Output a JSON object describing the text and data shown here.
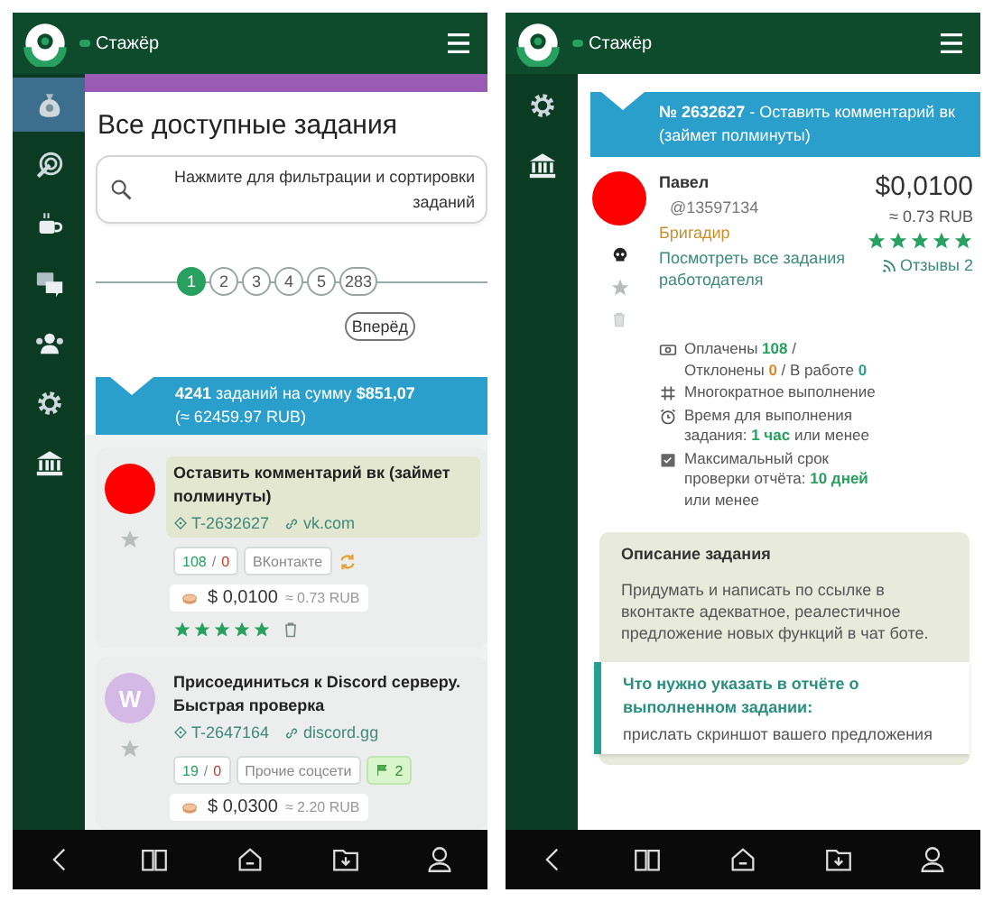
{
  "list_screen": {
    "header": {
      "role": "Стажёр"
    },
    "sidebar": [
      {
        "kind": "money",
        "selected": true
      },
      {
        "kind": "target",
        "selected": false
      },
      {
        "kind": "coffee",
        "selected": false
      },
      {
        "kind": "chat",
        "selected": false
      },
      {
        "kind": "people",
        "selected": false
      },
      {
        "kind": "gear",
        "selected": false
      },
      {
        "kind": "bank",
        "selected": false
      }
    ],
    "title": "Все доступные задания",
    "filter": {
      "label": "Нажмите для фильтрации и сортировки заданий"
    },
    "pagination": {
      "pages": [
        {
          "label": "1",
          "selected": true
        },
        {
          "label": "2",
          "selected": false
        },
        {
          "label": "3",
          "selected": false
        },
        {
          "label": "4",
          "selected": false
        },
        {
          "label": "5",
          "selected": false
        },
        {
          "label": "283",
          "selected": false
        }
      ],
      "next": "Вперёд"
    },
    "summary": {
      "text": "**4241** заданий на сумму **$851,07**",
      "rub": "(≈ 62459.97 RUB)"
    },
    "tasks": [
      {
        "title": "Оставить комментарий вк (займет полминуты)",
        "highlighted": true,
        "avatar": {
          "color": "#ff0000"
        },
        "id": "T-2632627",
        "site": "vk.com",
        "counts": "**108** / **0**",
        "category": "ВКонтакте",
        "repeat": true,
        "price": "$ 0,0100",
        "rub": "≈ 0.73 RUB",
        "stars": 5
      },
      {
        "title": "Присоединиться к Discord серверу. Быстрая проверка",
        "highlighted": false,
        "avatar": {
          "color": "#d4b8e6",
          "letter": "W"
        },
        "id": "T-2647164",
        "site": "discord.gg",
        "counts": "**19** / **0**",
        "category": "Прочие соцсети",
        "repeat": false,
        "bonus": "2",
        "price": "$ 0,0300",
        "rub": "≈ 2.20 RUB"
      }
    ]
  },
  "detail_screen": {
    "header": {
      "role": "Стажёр"
    },
    "sidebar": [
      {
        "kind": "gear",
        "selected": false
      },
      {
        "kind": "bank",
        "selected": false
      }
    ],
    "banner": "**№ 2632627** - Оставить комментарий вк (займет полминуты)",
    "employer": {
      "avatar": {
        "color": "#ff0000"
      },
      "name": "Павел",
      "handle": "@13597134",
      "rank": "Бригадир",
      "link": "Посмотреть все задания работодателя",
      "price": "$0,0100",
      "rub": "≈ 0.73 RUB",
      "stars": 5,
      "reviews": "Отзывы 2"
    },
    "stats": [
      {
        "kind": "paid",
        "text": "Оплачены **108** / Отклонены **0** / В работе **0**"
      },
      {
        "kind": "repeat",
        "text": "Многократное выполнение"
      },
      {
        "kind": "time",
        "text": "Время для выполнения задания: **1 час** или менее"
      },
      {
        "kind": "check",
        "text": "Максимальный срок проверки отчёта: **10 дней** или менее"
      }
    ],
    "description": {
      "heading": "Описание задания",
      "text": "Придумать и написать по ссылке в вконтакте адекватное, реалестичное предложение новых функций в чат боте."
    },
    "report": {
      "heading": "Что нужно указать в отчёте о выполненном задании:",
      "text": "прислать скриншот вашего предложения"
    }
  }
}
